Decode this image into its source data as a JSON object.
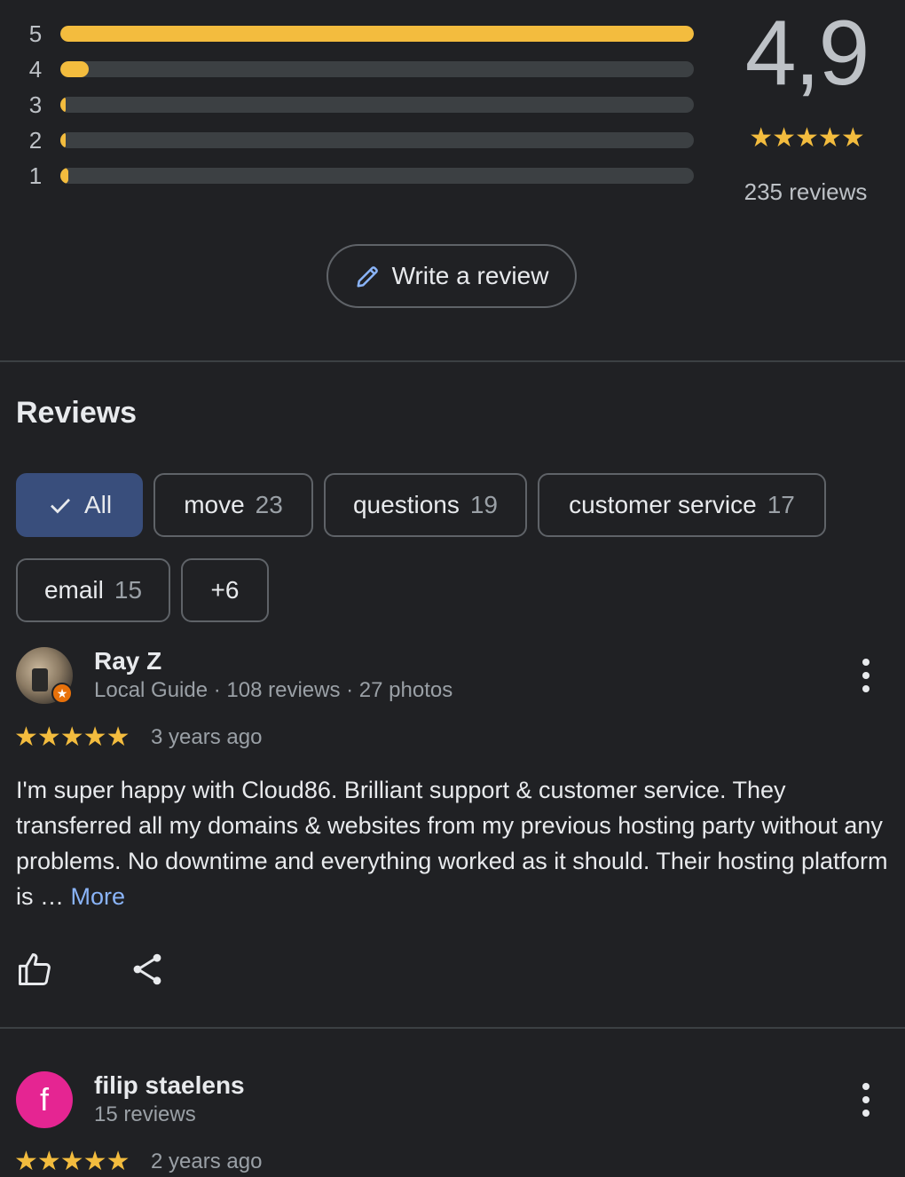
{
  "rating_summary": {
    "average": "4,9",
    "stars": "★★★★★",
    "count_label": "235 reviews",
    "distribution": [
      {
        "label": "5",
        "fraction": 1.0
      },
      {
        "label": "4",
        "fraction": 0.045
      },
      {
        "label": "3",
        "fraction": 0.008
      },
      {
        "label": "2",
        "fraction": 0.008
      },
      {
        "label": "1",
        "fraction": 0.012
      }
    ],
    "bar_color": "#f3bc3e"
  },
  "write_review": {
    "label": "Write a review",
    "icon": "pencil-icon"
  },
  "reviews_section": {
    "heading": "Reviews",
    "chips": [
      {
        "label": "All",
        "count": "",
        "selected": true
      },
      {
        "label": "move",
        "count": "23"
      },
      {
        "label": "questions",
        "count": "19"
      },
      {
        "label": "customer service",
        "count": "17"
      },
      {
        "label": "email",
        "count": "15"
      },
      {
        "label": "+6",
        "count": ""
      }
    ]
  },
  "reviews": [
    {
      "name": "Ray Z",
      "meta": "Local Guide · 108 reviews · 27 photos",
      "stars": "★★★★★",
      "date": "3 years ago",
      "text": "I'm super happy with Cloud86. Brilliant support & customer service. They transferred all my domains & websites from my previous hosting party without any problems. No downtime and everything worked as it should. Their hosting platform is … ",
      "more_label": "More"
    },
    {
      "name": "filip staelens",
      "avatar_letter": "f",
      "meta": "15 reviews",
      "stars": "★★★★★",
      "date": "2 years ago"
    }
  ]
}
